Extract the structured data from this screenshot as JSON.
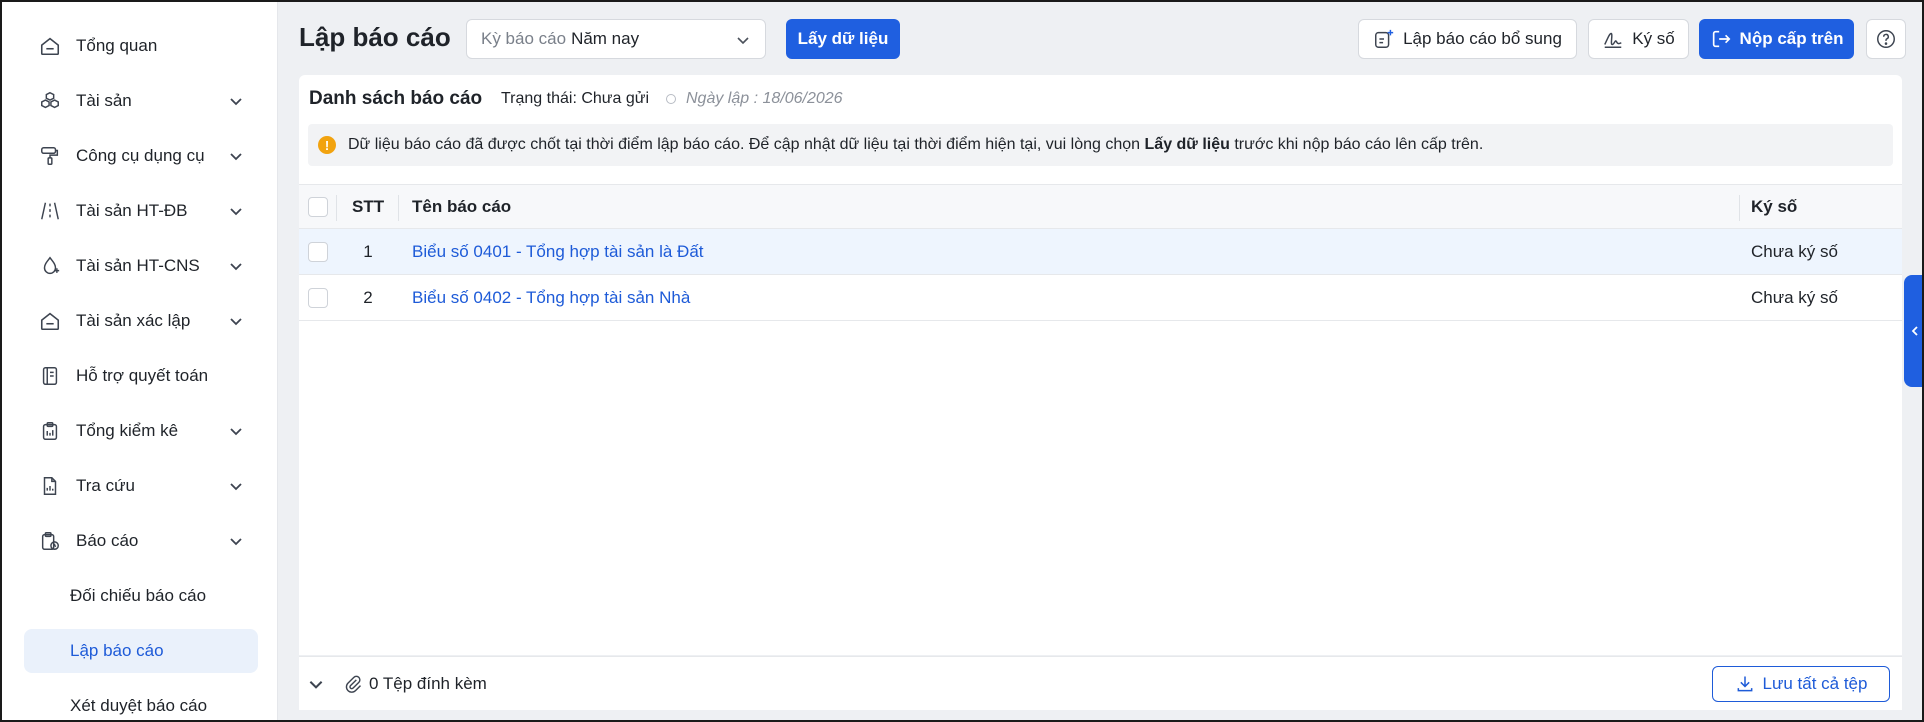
{
  "sidebar": {
    "items": [
      {
        "label": "Tổng quan",
        "icon": "home-icon",
        "expandable": false
      },
      {
        "label": "Tài sản",
        "icon": "boxes-icon",
        "expandable": true
      },
      {
        "label": "Công cụ dụng cụ",
        "icon": "paint-roller-icon",
        "expandable": true
      },
      {
        "label": "Tài sản HT-ĐB",
        "icon": "road-icon",
        "expandable": true
      },
      {
        "label": "Tài sản HT-CNS",
        "icon": "droplet-plus-icon",
        "expandable": true
      },
      {
        "label": "Tài sản xác lập",
        "icon": "inbox-icon",
        "expandable": true
      },
      {
        "label": "Hỗ trợ quyết toán",
        "icon": "ledger-icon",
        "expandable": false
      },
      {
        "label": "Tổng kiểm kê",
        "icon": "clipboard-icon",
        "expandable": true
      },
      {
        "label": "Tra cứu",
        "icon": "file-chart-icon",
        "expandable": true
      },
      {
        "label": "Báo cáo",
        "icon": "report-clock-icon",
        "expandable": true
      }
    ],
    "sub_items": [
      {
        "label": "Đối chiếu báo cáo",
        "active": false
      },
      {
        "label": "Lập báo cáo",
        "active": true
      },
      {
        "label": "Xét duyệt báo cáo",
        "active": false
      }
    ]
  },
  "header": {
    "title": "Lập báo cáo",
    "period_placeholder": "Kỳ báo cáo",
    "period_value": "Năm nay",
    "fetch_button": "Lấy dữ liệu",
    "supplement_button": "Lập báo cáo bổ sung",
    "sign_button": "Ký số",
    "submit_button": "Nộp cấp trên",
    "help_icon": "help-icon"
  },
  "panel": {
    "title": "Danh sách báo cáo",
    "status": "Trạng thái: Chưa gửi",
    "created_date": "Ngày lập : 18/06/2026",
    "alert": {
      "text_before": "Dữ liệu báo cáo đã được chốt tại thời điểm lập báo cáo. Để cập nhật dữ liệu tại thời điểm hiện tại, vui lòng chọn",
      "bold": "Lấy dữ liệu",
      "text_after": "trước khi nộp báo cáo lên cấp trên."
    }
  },
  "table": {
    "columns": [
      "STT",
      "Tên báo cáo",
      "Ký số"
    ],
    "rows": [
      {
        "stt": "1",
        "name": "Biểu số 0401 - Tổng hợp tài sản là Đất",
        "sign": "Chưa ký số"
      },
      {
        "stt": "2",
        "name": "Biểu số 0402 - Tổng hợp tài sản Nhà",
        "sign": "Chưa ký số"
      }
    ]
  },
  "footer": {
    "attachments": "0 Tệp đính kèm",
    "save_all": "Lưu tất cả tệp"
  },
  "colors": {
    "primary": "#1f5fe0",
    "link": "#1e5bd8",
    "warning": "#f2a30f",
    "active_bg": "#eaf1fb"
  }
}
